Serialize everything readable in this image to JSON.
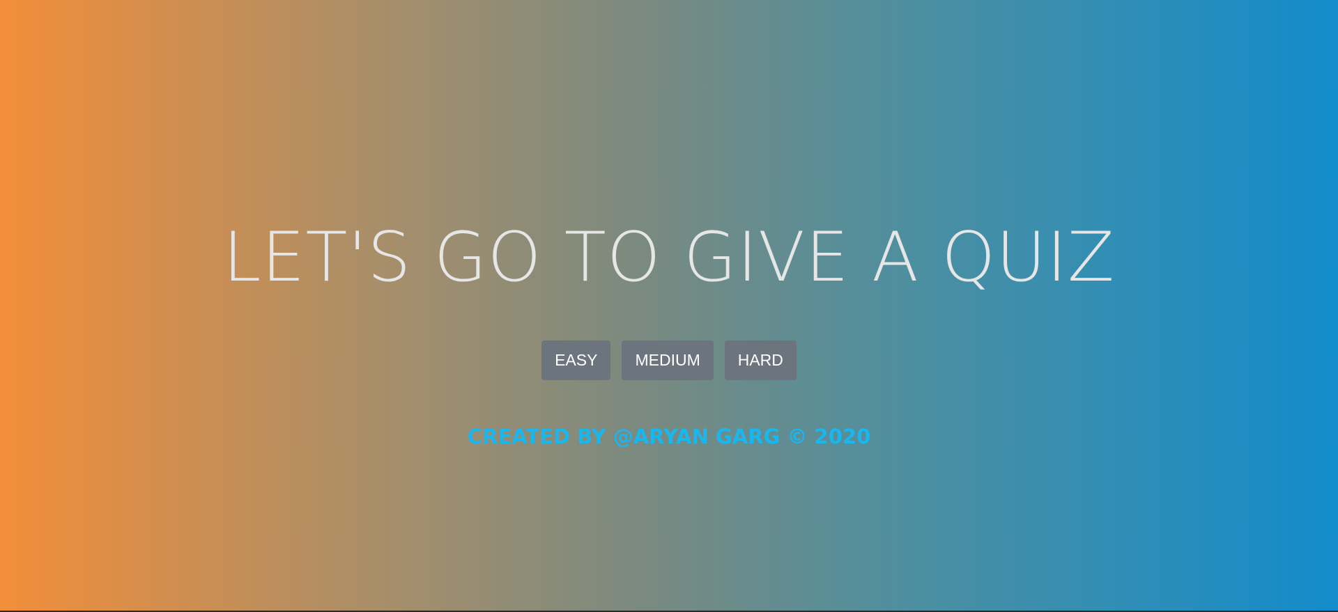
{
  "hero": {
    "title": "LET'S GO TO GIVE A QUIZ"
  },
  "difficulty_buttons": [
    {
      "label": "EASY"
    },
    {
      "label": "MEDIUM"
    },
    {
      "label": "HARD"
    }
  ],
  "footer": {
    "credit": "CREATED BY @ARYAN GARG © 2020"
  },
  "colors": {
    "gradient_start": "#f28e39",
    "gradient_end": "#128ccb",
    "title_text": "#e6e6e6",
    "button_bg": "#6c757d",
    "button_text": "#ffffff",
    "footer_text": "#1ab6ee"
  }
}
